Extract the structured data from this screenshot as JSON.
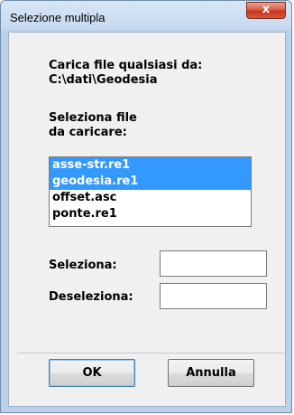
{
  "window": {
    "title": "Selezione multipla",
    "close_glyph": "x"
  },
  "info": {
    "load_label": "Carica file qualsiasi da:",
    "path": "C:\\dati\\Geodesia",
    "select_line1": "Seleziona file",
    "select_line2": "da caricare:"
  },
  "files": [
    {
      "name": "asse-str.re1",
      "selected": true
    },
    {
      "name": "geodesia.re1",
      "selected": true
    },
    {
      "name": "offset.asc",
      "selected": false
    },
    {
      "name": "ponte.re1",
      "selected": false
    }
  ],
  "select_field": {
    "label": "Seleziona:",
    "value": ""
  },
  "deselect_field": {
    "label": "Deseleziona:",
    "value": ""
  },
  "buttons": {
    "ok": "OK",
    "cancel": "Annulla"
  },
  "colors": {
    "selection": "#3399ff",
    "close_button": "#c4351e"
  }
}
